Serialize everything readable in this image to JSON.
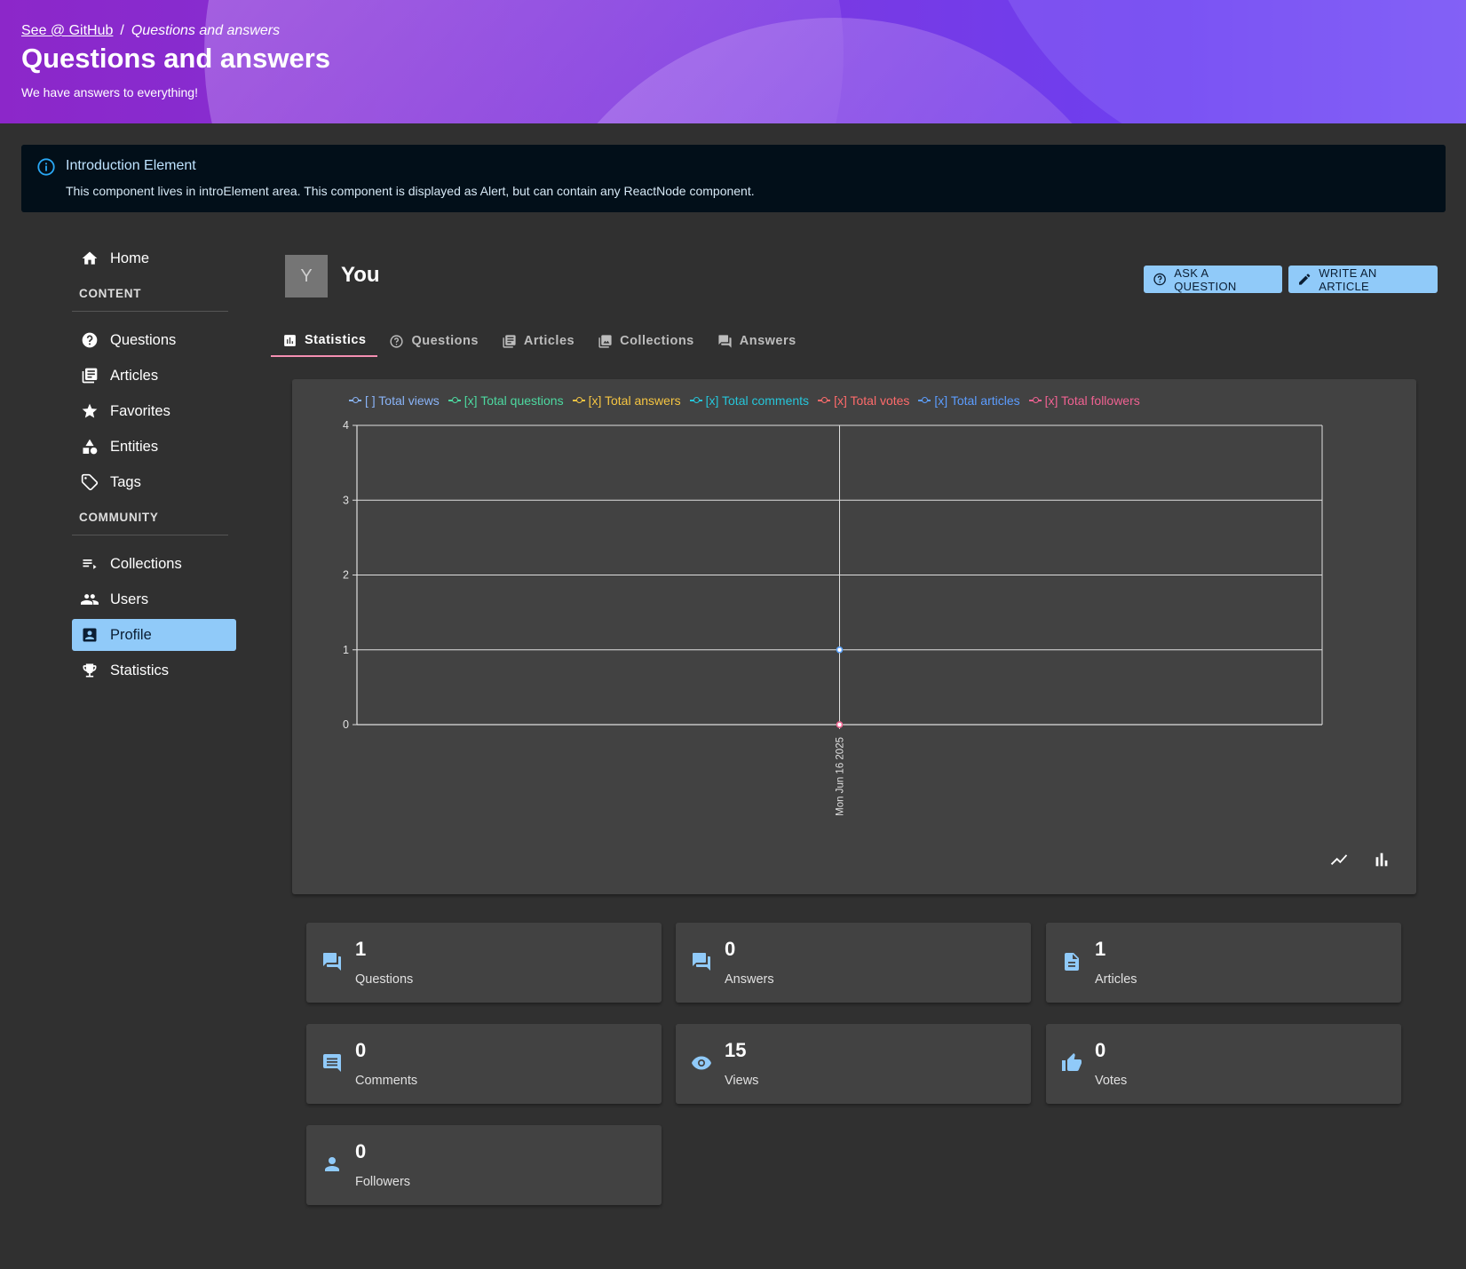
{
  "header": {
    "breadcrumb_link": "See @ GitHub",
    "breadcrumb_sep": "/",
    "breadcrumb_current": "Questions and answers",
    "title": "Questions and answers",
    "subtitle": "We have answers to everything!"
  },
  "alert": {
    "title": "Introduction Element",
    "body": "This component lives in introElement area. This component is displayed as Alert, but can contain any ReactNode component."
  },
  "sidebar": {
    "home": "Home",
    "content_header": "CONTENT",
    "content_items": [
      "Questions",
      "Articles",
      "Favorites",
      "Entities",
      "Tags"
    ],
    "community_header": "COMMUNITY",
    "community_items": [
      "Collections",
      "Users",
      "Profile",
      "Statistics"
    ],
    "active": "Profile"
  },
  "profile": {
    "avatar_letter": "Y",
    "name": "You",
    "ask_button": "ASK A QUESTION",
    "write_button": "WRITE AN ARTICLE"
  },
  "tabs": [
    "Statistics",
    "Questions",
    "Articles",
    "Collections",
    "Answers"
  ],
  "active_tab": "Statistics",
  "chart_data": {
    "type": "line",
    "x": [
      "Mon Jun 16 2025"
    ],
    "ylim": [
      0,
      4
    ],
    "yticks": [
      0,
      1,
      2,
      3,
      4
    ],
    "grid": true,
    "legend_position": "top",
    "series": [
      {
        "name": "Total views",
        "legend_label": "[ ] Total views",
        "color": "#8ab4f8",
        "visible": false,
        "values": [
          15
        ]
      },
      {
        "name": "Total questions",
        "legend_label": "[x] Total questions",
        "color": "#4dd9a0",
        "visible": true,
        "values": [
          1
        ]
      },
      {
        "name": "Total answers",
        "legend_label": "[x] Total answers",
        "color": "#f5c542",
        "visible": true,
        "values": [
          0
        ]
      },
      {
        "name": "Total comments",
        "legend_label": "[x] Total comments",
        "color": "#26c6da",
        "visible": true,
        "values": [
          0
        ]
      },
      {
        "name": "Total votes",
        "legend_label": "[x] Total votes",
        "color": "#ff6b6b",
        "visible": true,
        "values": [
          0
        ]
      },
      {
        "name": "Total articles",
        "legend_label": "[x] Total articles",
        "color": "#5c9dff",
        "visible": true,
        "values": [
          1
        ]
      },
      {
        "name": "Total followers",
        "legend_label": "[x] Total followers",
        "color": "#f06292",
        "visible": true,
        "values": [
          0
        ]
      }
    ]
  },
  "stats": [
    {
      "value": "1",
      "label": "Questions",
      "icon": "forum-icon"
    },
    {
      "value": "0",
      "label": "Answers",
      "icon": "forum-icon"
    },
    {
      "value": "1",
      "label": "Articles",
      "icon": "article-icon"
    },
    {
      "value": "0",
      "label": "Comments",
      "icon": "comment-icon"
    },
    {
      "value": "15",
      "label": "Views",
      "icon": "eye-icon"
    },
    {
      "value": "0",
      "label": "Votes",
      "icon": "thumb-up-icon"
    },
    {
      "value": "0",
      "label": "Followers",
      "icon": "person-icon"
    }
  ],
  "colors": {
    "accent": "#90caf9",
    "tab_indicator": "#f48fb1",
    "background": "#303030",
    "panel": "#424242"
  }
}
